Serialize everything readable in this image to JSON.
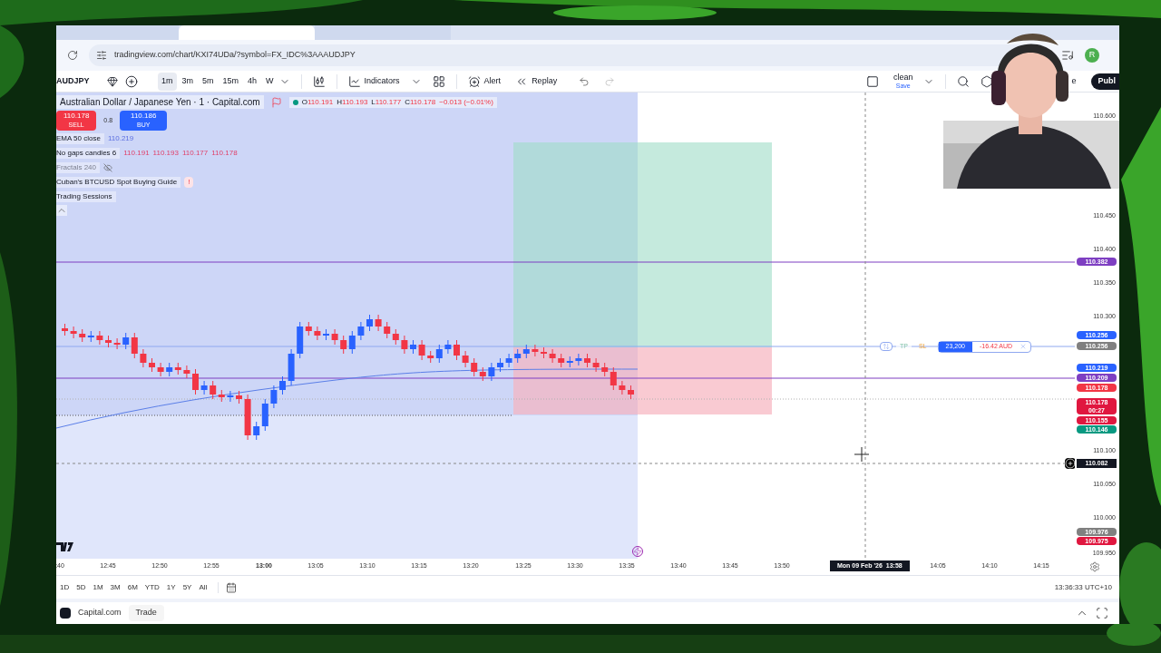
{
  "browser": {
    "tabs": [
      {
        "selected": false
      },
      {
        "selected": true
      },
      {
        "selected": false
      }
    ],
    "url": "tradingview.com/chart/KXI74UDa/?symbol=FX_IDC%3AAAUDJPY",
    "avatar": "R"
  },
  "toolbar": {
    "symbol": "AUDJPY",
    "intervals": [
      {
        "label": "1m",
        "selected": true
      },
      {
        "label": "3m",
        "selected": false
      },
      {
        "label": "5m",
        "selected": false
      },
      {
        "label": "15m",
        "selected": false
      },
      {
        "label": "4h",
        "selected": false
      },
      {
        "label": "W",
        "selected": false
      }
    ],
    "indicators": "Indicators",
    "alert": "Alert",
    "replay": "Replay",
    "layout_name": "clean",
    "layout_status": "Save",
    "trade_fragment": "e",
    "publish": "Publ"
  },
  "legend": {
    "title": "Australian Dollar / Japanese Yen · 1 · Capital.com",
    "ohlc": [
      {
        "label": "O",
        "value": "110.191"
      },
      {
        "label": "H",
        "value": "110.193"
      },
      {
        "label": "L",
        "value": "110.177"
      },
      {
        "label": "C",
        "value": "110.178"
      }
    ],
    "change": "−0.013 (−0.01%)",
    "sell": {
      "price": "110.178",
      "label": "SELL"
    },
    "spread": "0.8",
    "buy": {
      "price": "110.186",
      "label": "BUY"
    },
    "studies": [
      {
        "name": "EMA 50 close",
        "values": [
          "110.219"
        ],
        "hidden": false
      },
      {
        "name": "No gaps candles 6",
        "values": [
          "110.191",
          "110.193",
          "110.177",
          "110.178"
        ],
        "hidden": false
      },
      {
        "name": "Fractals 240",
        "hidden": true
      },
      {
        "name": "Cuban's BTCUSD Spot Buying Guide",
        "hidden": false,
        "badge": "!"
      },
      {
        "name": "Trading Sessions",
        "hidden": false
      }
    ]
  },
  "position": {
    "tp": "TP",
    "sl": "SL",
    "quantity": "23,200",
    "pnl": "-16.42 AUD"
  },
  "price_axis": {
    "ticks": [
      "110.600",
      "110.450",
      "110.400",
      "110.350",
      "110.300",
      "110.100",
      "110.050",
      "110.000",
      "109.950"
    ],
    "tags": [
      {
        "lines": [
          "110.382"
        ],
        "color": "#7e3fc2"
      },
      {
        "lines": [
          "110.256"
        ],
        "color": "#2962ff"
      },
      {
        "lines": [
          "110.256"
        ],
        "color": "#808080"
      },
      {
        "lines": [
          "110.219"
        ],
        "color": "#2962ff"
      },
      {
        "lines": [
          "110.209"
        ],
        "color": "#7e3fc2"
      },
      {
        "lines": [
          "110.178"
        ],
        "color": "#f23645"
      },
      {
        "lines": [
          "110.178",
          "00:27"
        ],
        "color": "#e0173f"
      },
      {
        "lines": [
          "110.155"
        ],
        "color": "#e0173f"
      },
      {
        "lines": [
          "110.146"
        ],
        "color": "#089981"
      },
      {
        "lines": [
          "109.976"
        ],
        "color": "#808080"
      },
      {
        "lines": [
          "109.975"
        ],
        "color": "#e0173f"
      }
    ],
    "crosshair_price": "110.082"
  },
  "time_axis": {
    "labels": [
      {
        "text": ":40",
        "major": false
      },
      {
        "text": "12:45",
        "major": false
      },
      {
        "text": "12:50",
        "major": false
      },
      {
        "text": "12:55",
        "major": false
      },
      {
        "text": "13:00",
        "major": true
      },
      {
        "text": "13:05",
        "major": false
      },
      {
        "text": "13:10",
        "major": false
      },
      {
        "text": "13:15",
        "major": false
      },
      {
        "text": "13:20",
        "major": false
      },
      {
        "text": "13:25",
        "major": false
      },
      {
        "text": "13:30",
        "major": false
      },
      {
        "text": "13:35",
        "major": false
      },
      {
        "text": "13:40",
        "major": false
      },
      {
        "text": "13:45",
        "major": false
      },
      {
        "text": "13:50",
        "major": false
      },
      {
        "text": "14:05",
        "major": false
      },
      {
        "text": "14:10",
        "major": false
      },
      {
        "text": "14:15",
        "major": false
      }
    ],
    "crosshair_time": "Mon 09 Feb '26  13:58"
  },
  "range_bar": {
    "ranges": [
      "1D",
      "5D",
      "1M",
      "3M",
      "6M",
      "YTD",
      "1Y",
      "5Y",
      "All"
    ],
    "clock": "13:36:33 UTC+10"
  },
  "bottom_bar": {
    "broker": "Capital.com",
    "tabs": [
      "Trade"
    ]
  }
}
